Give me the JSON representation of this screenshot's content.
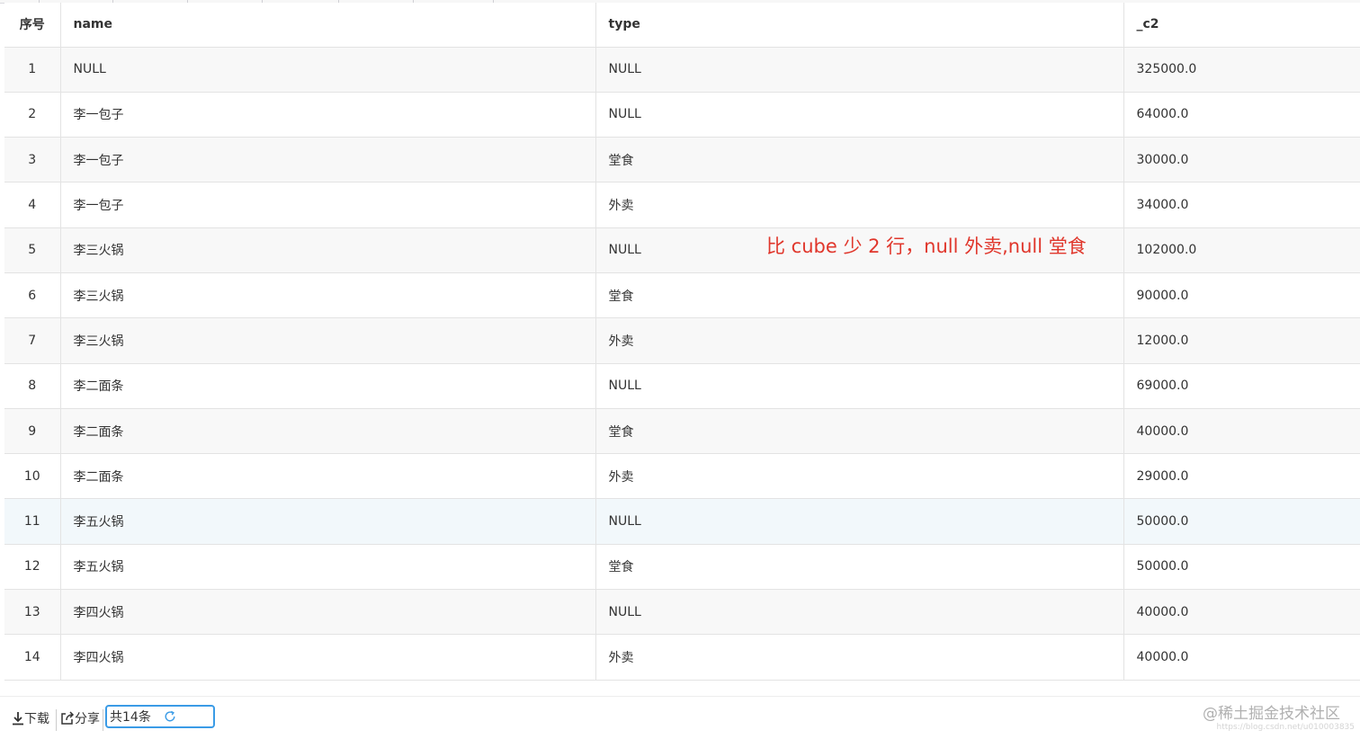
{
  "table": {
    "columns": [
      "序号",
      "name",
      "type",
      "_c2"
    ],
    "rows": [
      {
        "idx": "1",
        "name": "NULL",
        "type": "NULL",
        "c2": "325000.0"
      },
      {
        "idx": "2",
        "name": "李一包子",
        "type": "NULL",
        "c2": "64000.0"
      },
      {
        "idx": "3",
        "name": "李一包子",
        "type": "堂食",
        "c2": "30000.0"
      },
      {
        "idx": "4",
        "name": "李一包子",
        "type": "外卖",
        "c2": "34000.0"
      },
      {
        "idx": "5",
        "name": "李三火锅",
        "type": "NULL",
        "c2": "102000.0"
      },
      {
        "idx": "6",
        "name": "李三火锅",
        "type": "堂食",
        "c2": "90000.0"
      },
      {
        "idx": "7",
        "name": "李三火锅",
        "type": "外卖",
        "c2": "12000.0"
      },
      {
        "idx": "8",
        "name": "李二面条",
        "type": "NULL",
        "c2": "69000.0"
      },
      {
        "idx": "9",
        "name": "李二面条",
        "type": "堂食",
        "c2": "40000.0"
      },
      {
        "idx": "10",
        "name": "李二面条",
        "type": "外卖",
        "c2": "29000.0"
      },
      {
        "idx": "11",
        "name": "李五火锅",
        "type": "NULL",
        "c2": "50000.0"
      },
      {
        "idx": "12",
        "name": "李五火锅",
        "type": "堂食",
        "c2": "50000.0"
      },
      {
        "idx": "13",
        "name": "李四火锅",
        "type": "NULL",
        "c2": "40000.0"
      },
      {
        "idx": "14",
        "name": "李四火锅",
        "type": "外卖",
        "c2": "40000.0"
      }
    ],
    "highlighted_row": "11"
  },
  "annotation": "比 cube 少 2 行，null 外卖,null 堂食",
  "footer": {
    "download_label": "下载",
    "share_label": "分享",
    "count_label": "共14条"
  },
  "watermark": {
    "text": "@稀土掘金技术社区",
    "url": "https://blog.csdn.net/u010003835"
  },
  "colors": {
    "annotation": "#e0362b",
    "count_box_border": "#3a9be6",
    "highlight_row": "#f2f8fb"
  }
}
